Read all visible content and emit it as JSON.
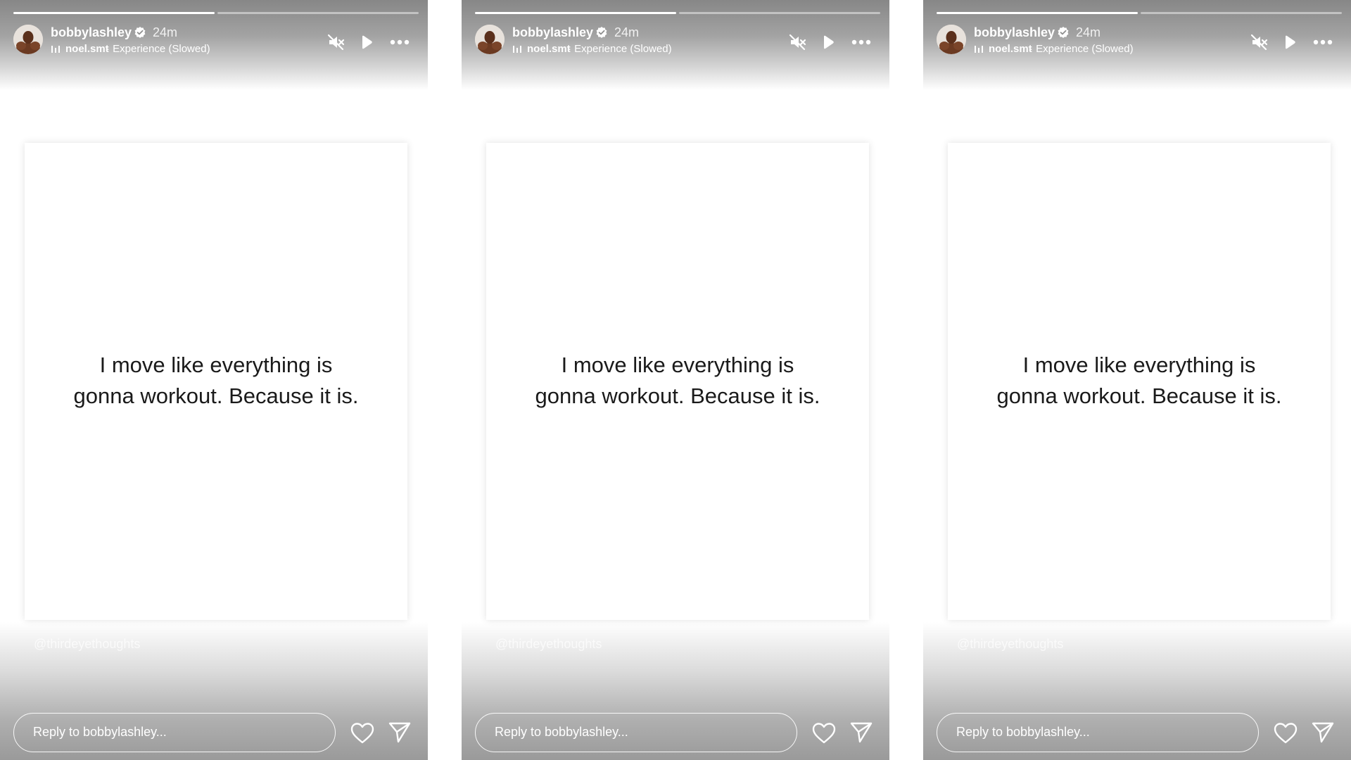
{
  "stories": [
    {
      "username": "bobbylashley",
      "time": "24m",
      "artist": "noel.smt",
      "song": "· Experience (Slowed)",
      "progress": [
        1.0,
        0.0
      ],
      "quote_line1": "I move like everything is",
      "quote_line2": "gonna workout. Because it is.",
      "watermark": "@thirdeyethoughts",
      "reply_placeholder": "Reply to bobbylashley..."
    },
    {
      "username": "bobbylashley",
      "time": "24m",
      "artist": "noel.smt",
      "song": "· Experience (Slowed)",
      "progress": [
        1.0,
        0.0
      ],
      "quote_line1": "I move like everything is",
      "quote_line2": "gonna workout. Because it is.",
      "watermark": "@thirdeyethoughts",
      "reply_placeholder": "Reply to bobbylashley..."
    },
    {
      "username": "bobbylashley",
      "time": "24m",
      "artist": "noel.smt",
      "song": "· Experience (Slowed)",
      "progress": [
        1.0,
        0.0
      ],
      "quote_line1": "I move like everything is",
      "quote_line2": "gonna workout. Because it is.",
      "watermark": "@thirdeyethoughts",
      "reply_placeholder": "Reply to bobbylashley..."
    }
  ],
  "icons": {
    "verified": "verified-badge-icon",
    "music": "music-bars-icon",
    "mute": "speaker-muted-icon",
    "play": "play-icon",
    "more": "more-dots-icon",
    "heart": "heart-icon",
    "send": "send-paper-plane-icon"
  },
  "colors": {
    "header_gradient": "#878787",
    "card_background": "#ffffff",
    "quote_text": "#1a1a1a",
    "overlay_text": "#ffffff"
  }
}
